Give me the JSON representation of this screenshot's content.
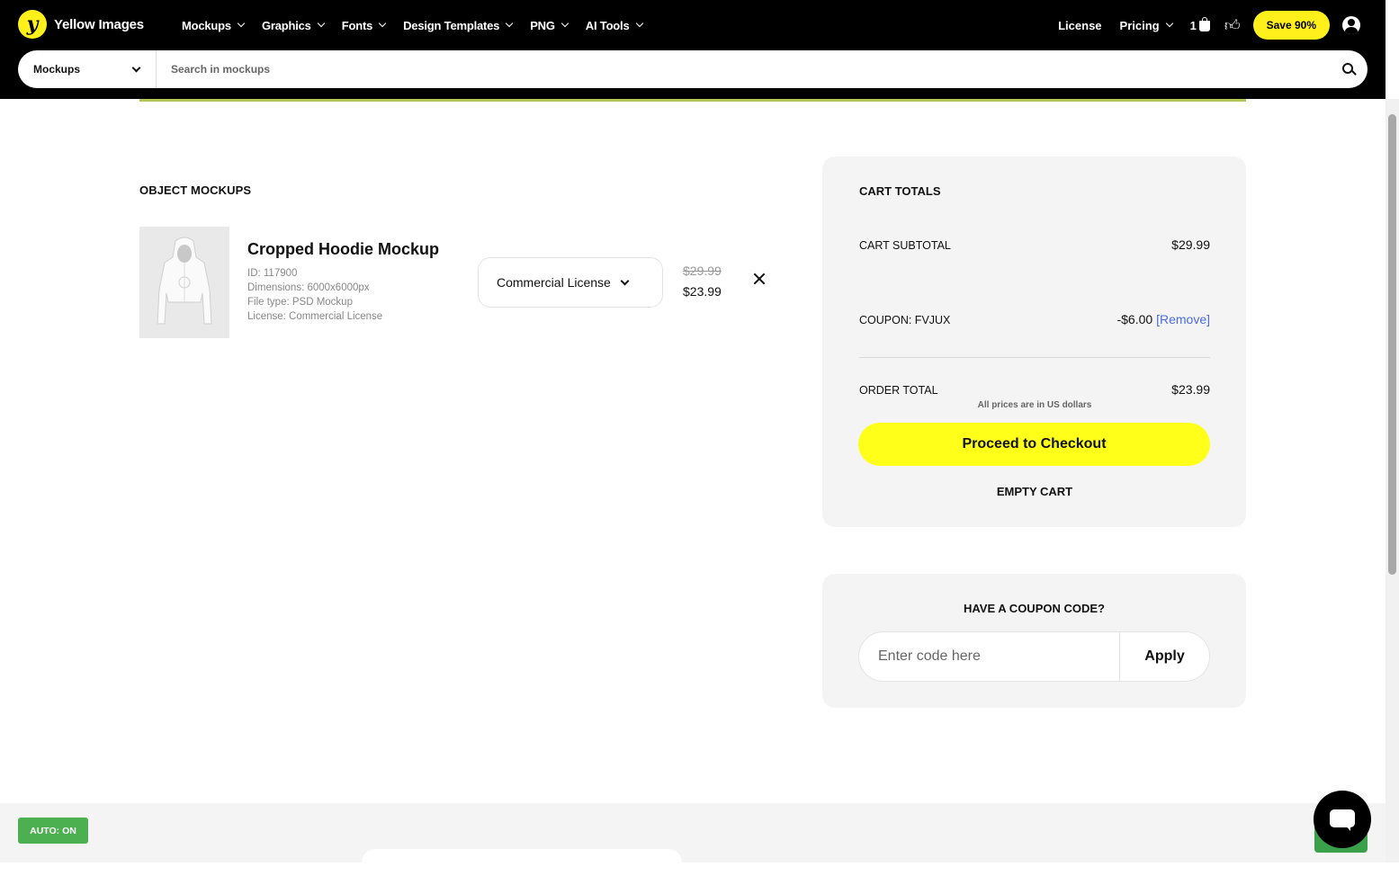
{
  "header": {
    "brand": "Yellow Images",
    "nav": [
      {
        "label": "Mockups"
      },
      {
        "label": "Graphics"
      },
      {
        "label": "Fonts"
      },
      {
        "label": "Design Templates"
      },
      {
        "label": "PNG"
      },
      {
        "label": "AI Tools"
      }
    ],
    "license_label": "License",
    "pricing_label": "Pricing",
    "cart_count": "1",
    "save_label": "Save 90%"
  },
  "search": {
    "category": "Mockups",
    "placeholder": "Search in mockups"
  },
  "cart": {
    "section_title": "OBJECT MOCKUPS",
    "item": {
      "title": "Cropped Hoodie Mockup",
      "id_line": "ID:  117900",
      "dimensions_line": "Dimensions:  6000x6000px",
      "filetype_line": "File type:  PSD Mockup",
      "license_line": "License:  Commercial License",
      "license_select": "Commercial License",
      "price_old": "$29.99",
      "price_new": "$23.99"
    }
  },
  "totals": {
    "title": "CART TOTALS",
    "subtotal_label": "CART SUBTOTAL",
    "subtotal_value": "$29.99",
    "coupon_label": "COUPON: FVJUX",
    "coupon_value": "-$6.00",
    "coupon_remove": "[Remove]",
    "order_total_label": "ORDER TOTAL",
    "order_total_value": "$23.99",
    "note": "All prices are in US dollars",
    "checkout_label": "Proceed to Checkout",
    "empty_cart_label": "EMPTY CART"
  },
  "coupon": {
    "title": "HAVE A COUPON CODE?",
    "placeholder": "Enter code here",
    "apply_label": "Apply"
  },
  "auto_badge": "AUTO: ON",
  "colors": {
    "accent_yellow": "#ffef1a",
    "checkout_yellow": "#ffff1a",
    "link_blue": "#4a6be0",
    "badge_green": "#4caf50"
  },
  "icons": [
    "logo-mark",
    "chevron-down-icon",
    "shopping-bag-icon",
    "thumbs-up-icon",
    "user-icon",
    "search-icon",
    "close-icon",
    "chat-icon"
  ]
}
